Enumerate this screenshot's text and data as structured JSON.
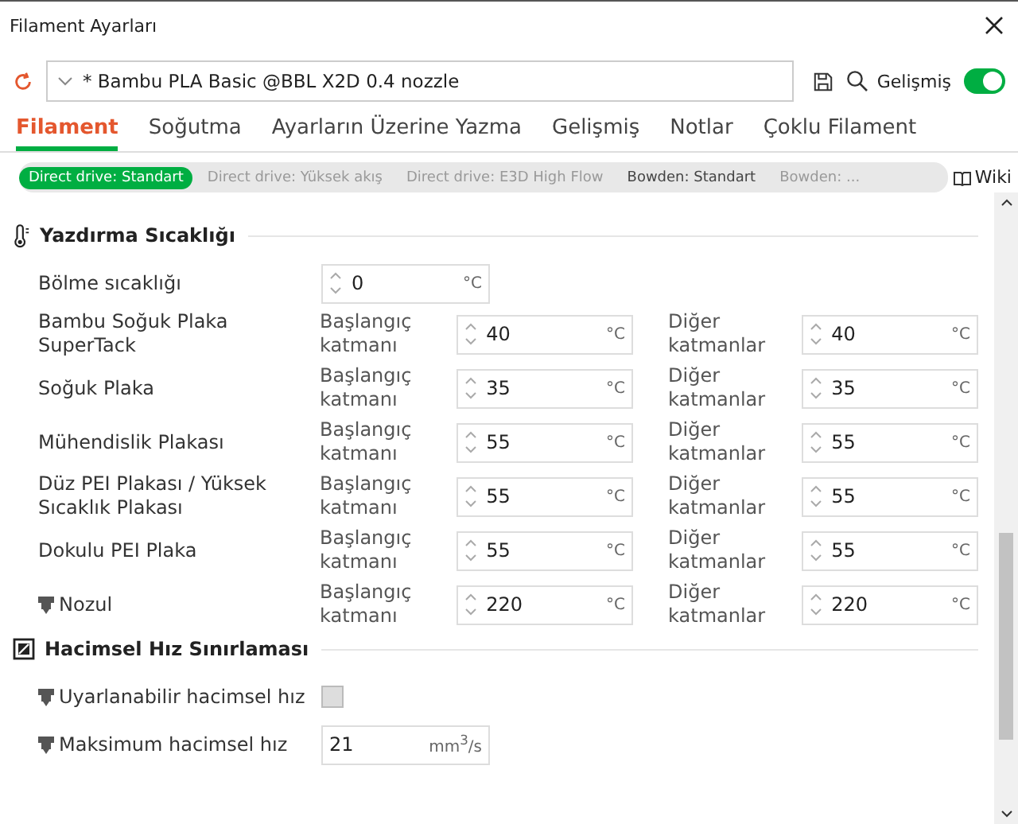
{
  "window": {
    "title": "Filament Ayarları"
  },
  "preset": {
    "value": "* Bambu PLA Basic @BBL X2D 0.4 nozzle"
  },
  "advanced_toggle": {
    "label": "Gelişmiş",
    "on": true
  },
  "tabs": [
    {
      "label": "Filament",
      "selected": true
    },
    {
      "label": "Soğutma",
      "selected": false
    },
    {
      "label": "Ayarların Üzerine Yazma",
      "selected": false
    },
    {
      "label": "Gelişmiş",
      "selected": false
    },
    {
      "label": "Notlar",
      "selected": false
    },
    {
      "label": "Çoklu Filament",
      "selected": false
    }
  ],
  "variants": [
    {
      "label": "Direct drive: Standart",
      "selected": true,
      "emphasis": false
    },
    {
      "label": "Direct drive: Yüksek akış",
      "selected": false,
      "emphasis": false
    },
    {
      "label": "Direct drive: E3D High Flow",
      "selected": false,
      "emphasis": false
    },
    {
      "label": "Bowden: Standart",
      "selected": false,
      "emphasis": true
    },
    {
      "label": "Bowden: ...",
      "selected": false,
      "emphasis": false
    }
  ],
  "wiki_link": "Wiki",
  "sections": [
    {
      "title": "Yazdırma Sıcaklığı",
      "rows": [
        {
          "kind": "single",
          "label": "Bölme sıcaklığı",
          "nozzle_icon": false,
          "value": "0",
          "unit": "°C"
        },
        {
          "kind": "pair",
          "label": "Bambu Soğuk Plaka SuperTack",
          "nozzle_icon": false,
          "fields": [
            {
              "label": "Başlangıç katmanı",
              "value": "40",
              "unit": "°C"
            },
            {
              "label": "Diğer katmanlar",
              "value": "40",
              "unit": "°C"
            }
          ]
        },
        {
          "kind": "pair",
          "label": "Soğuk Plaka",
          "nozzle_icon": false,
          "fields": [
            {
              "label": "Başlangıç katmanı",
              "value": "35",
              "unit": "°C"
            },
            {
              "label": "Diğer katmanlar",
              "value": "35",
              "unit": "°C"
            }
          ]
        },
        {
          "kind": "pair",
          "label": "Mühendislik Plakası",
          "nozzle_icon": false,
          "fields": [
            {
              "label": "Başlangıç katmanı",
              "value": "55",
              "unit": "°C"
            },
            {
              "label": "Diğer katmanlar",
              "value": "55",
              "unit": "°C"
            }
          ]
        },
        {
          "kind": "pair",
          "label": "Düz PEI Plakası / Yüksek Sıcaklık Plakası",
          "nozzle_icon": false,
          "fields": [
            {
              "label": "Başlangıç katmanı",
              "value": "55",
              "unit": "°C"
            },
            {
              "label": "Diğer katmanlar",
              "value": "55",
              "unit": "°C"
            }
          ]
        },
        {
          "kind": "pair",
          "label": "Dokulu PEI Plaka",
          "nozzle_icon": false,
          "fields": [
            {
              "label": "Başlangıç katmanı",
              "value": "55",
              "unit": "°C"
            },
            {
              "label": "Diğer katmanlar",
              "value": "55",
              "unit": "°C"
            }
          ]
        },
        {
          "kind": "pair",
          "label": "Nozul",
          "nozzle_icon": true,
          "fields": [
            {
              "label": "Başlangıç katmanı",
              "value": "220",
              "unit": "°C"
            },
            {
              "label": "Diğer katmanlar",
              "value": "220",
              "unit": "°C"
            }
          ]
        }
      ]
    },
    {
      "title": "Hacimsel Hız Sınırlaması",
      "rows": [
        {
          "kind": "checkbox",
          "label": "Uyarlanabilir hacimsel hız",
          "nozzle_icon": true,
          "checked": false
        },
        {
          "kind": "single",
          "label": "Maksimum hacimsel hız",
          "nozzle_icon": true,
          "value": "21",
          "unit": "mm$^{3}$/s"
        }
      ]
    }
  ]
}
